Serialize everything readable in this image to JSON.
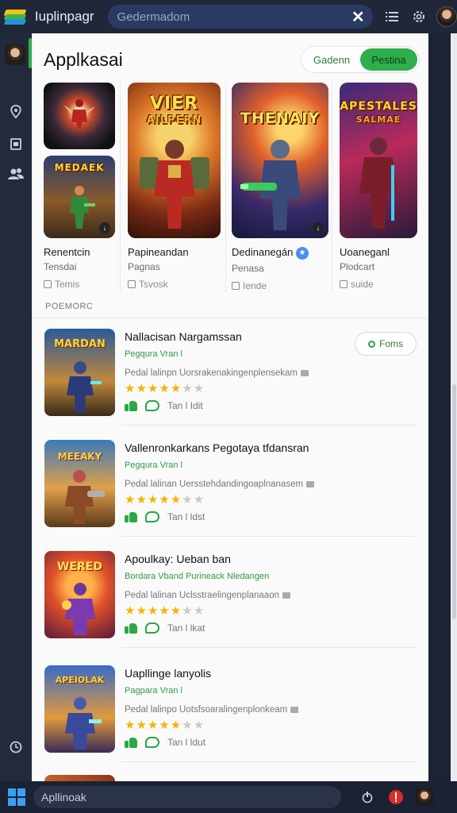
{
  "topbar": {
    "app_title": "Iuplinpagr",
    "search_placeholder": "Gedermadom",
    "clear_icon": "close-icon",
    "icons": [
      "list-icon",
      "settings-icon",
      "avatar"
    ]
  },
  "rail": {
    "icons": [
      "map-pin-icon",
      "folder-icon",
      "people-icon",
      "clock-icon"
    ]
  },
  "panel": {
    "title": "Applkasai",
    "segments": [
      {
        "label": "Gadenn",
        "active": false
      },
      {
        "label": "Pestina",
        "active": true
      }
    ]
  },
  "featured": [
    {
      "name": "Renentcin",
      "sub": "Tensdai",
      "tag": "Temis",
      "logo_top": "",
      "logo_bottom": "MEDAEK"
    },
    {
      "name": "Papineandan",
      "sub": "Pagnas",
      "tag": "Tsvosk",
      "logo_top": "VIER",
      "logo_bottom": "AILPERN"
    },
    {
      "name": "Dedinanegán",
      "sub": "Penasa",
      "tag": "Iende",
      "logo_top": "THENAIY",
      "logo_bottom": ""
    },
    {
      "name": "Uoaneganl",
      "sub": "Plodcart",
      "tag": "suide",
      "logo_top": "APESTALES",
      "logo_bottom": "SALMAE"
    }
  ],
  "section_label": "POEMORC",
  "list": [
    {
      "title": "Nallacisan Nargamssan",
      "dev": "Pegqura Vran l",
      "desc": "Pedal lalinpn Uorsrakenakingenplensekam",
      "rating": 4,
      "action_label": "Tan l Idit",
      "logo": "MARDAN",
      "button": "Foms"
    },
    {
      "title": "Vallenronkarkans Pegotaya  tfdansran",
      "dev": "Pegqura Vran l",
      "desc": "Pedal lalinan Uersstehdandingoaplnanasem",
      "rating": 4,
      "action_label": "Tan l ldst",
      "logo": "MEEAKY",
      "button": ""
    },
    {
      "title": "Apoulkay: Ueban ban",
      "dev": "Bordara Vband Purineack  Nledangen",
      "desc": "Pedal lalinan Uclsstraelingenplanaaon",
      "rating": 4,
      "action_label": "Tan l lkat",
      "logo": "WERED",
      "button": ""
    },
    {
      "title": "Uapllinge lanyolis",
      "dev": "Pagpara Vran l",
      "desc": "Pedal lalinpo Uotsfsoaralingenplonkeam",
      "rating": 4,
      "action_label": "Tan l ldut",
      "logo": "APEIOLAK",
      "button": ""
    }
  ],
  "taskbar": {
    "search_placeholder": "Apllinoak",
    "icons": [
      "windows-icon",
      "power-icon",
      "record-icon",
      "avatar"
    ]
  }
}
